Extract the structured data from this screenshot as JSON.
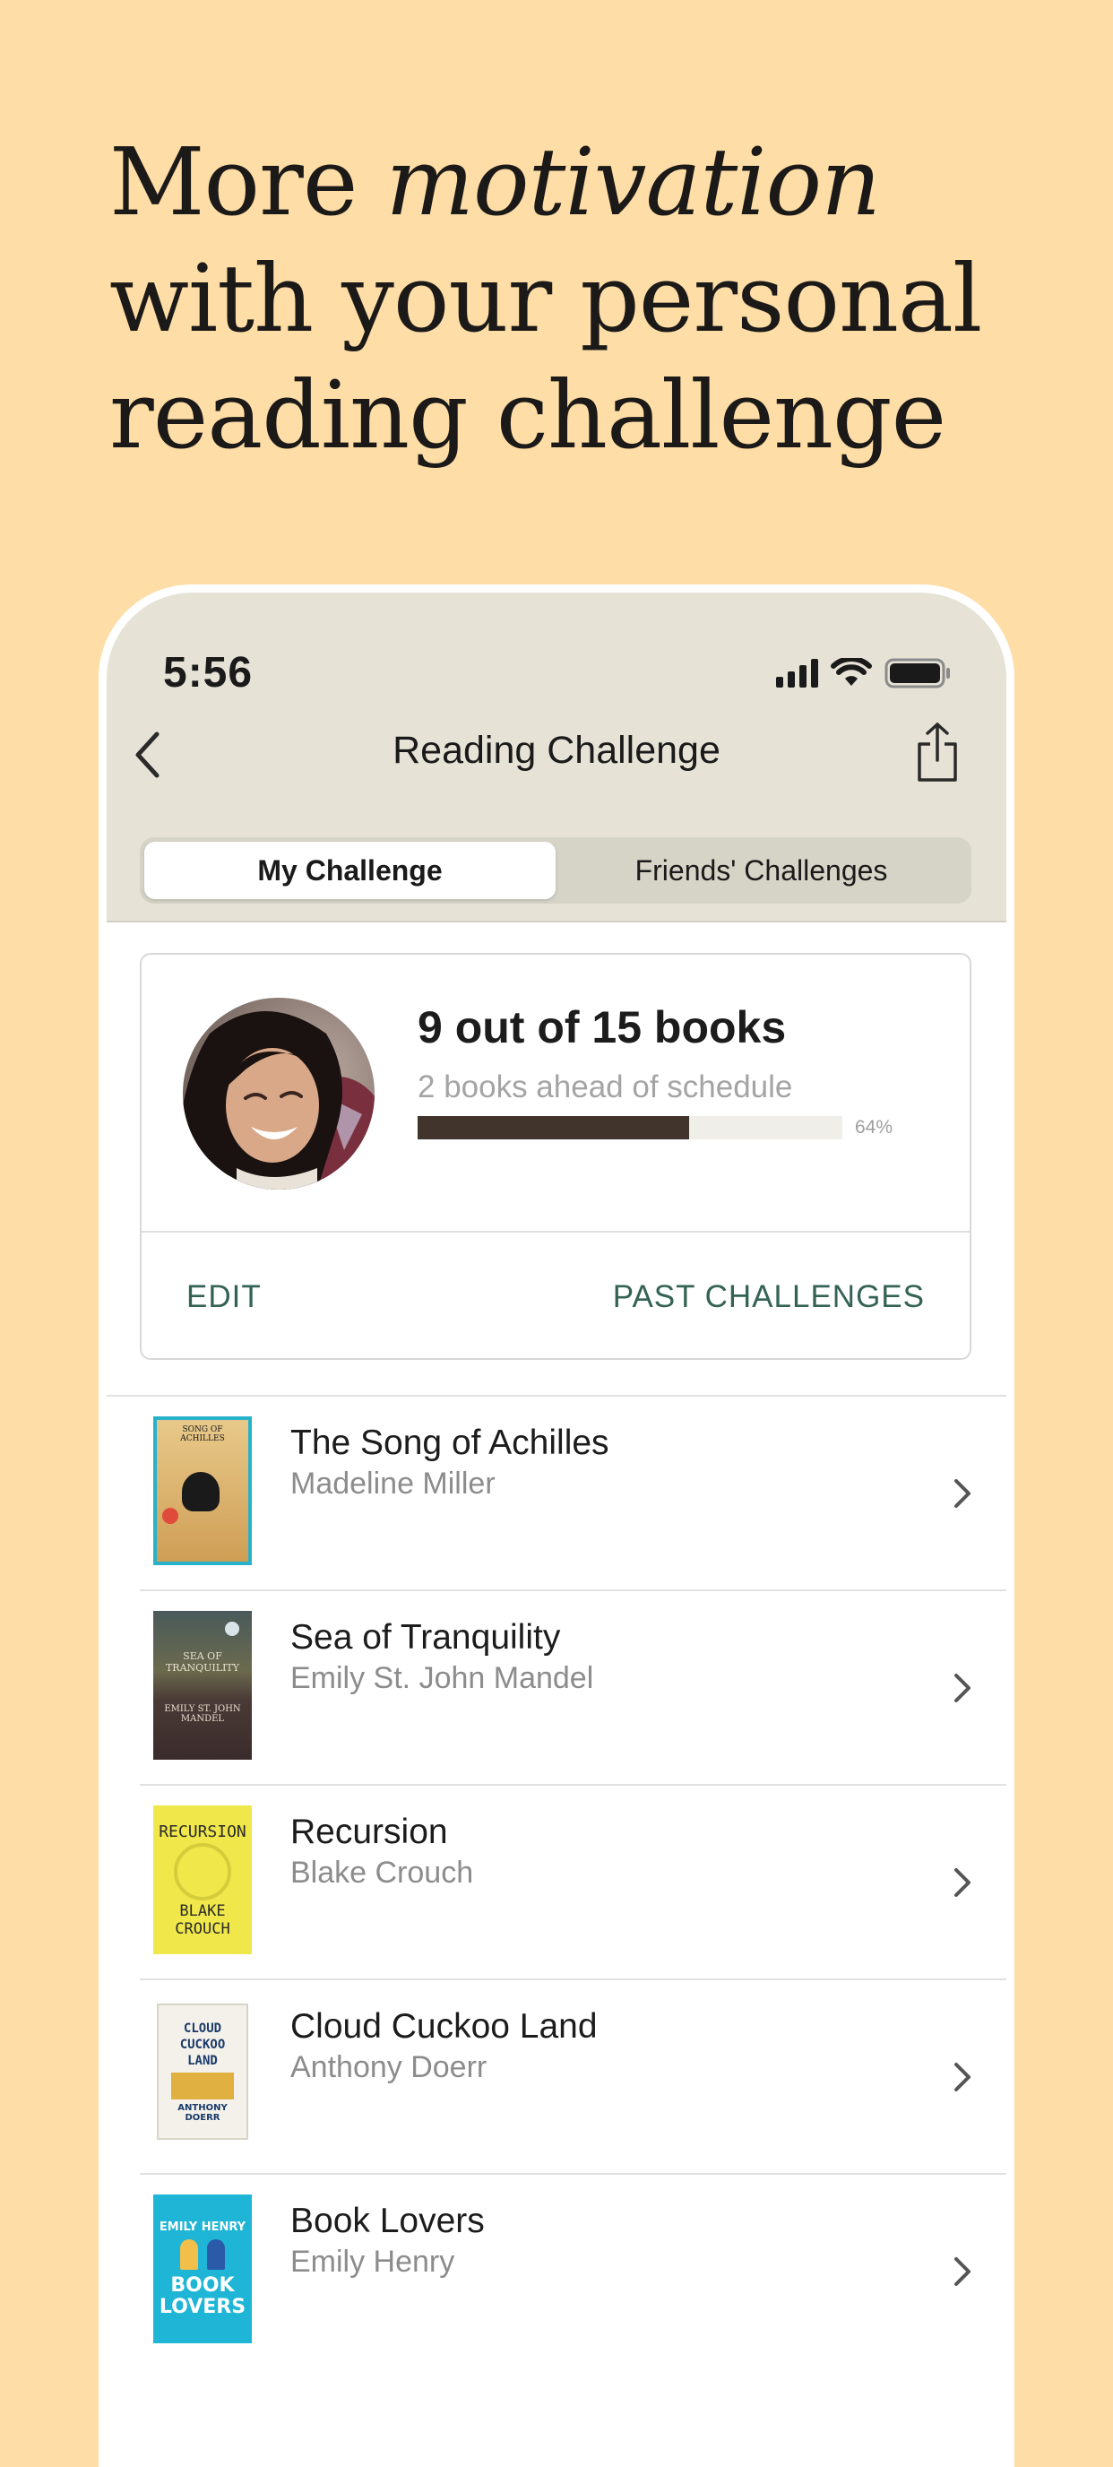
{
  "headline": {
    "line1_pre": "More ",
    "line1_em": "motivation",
    "line2": "with your personal",
    "line3": "reading challenge"
  },
  "status_bar": {
    "time": "5:56",
    "icons": [
      "signal-icon",
      "wifi-icon",
      "battery-icon"
    ]
  },
  "nav": {
    "title": "Reading Challenge",
    "back_icon": "chevron-left-icon",
    "share_icon": "share-icon"
  },
  "tabs": [
    {
      "label": "My Challenge",
      "active": true
    },
    {
      "label": "Friends' Challenges",
      "active": false
    }
  ],
  "challenge": {
    "title": "9 out of 15 books",
    "subtitle": "2 books ahead of schedule",
    "progress_percent": 64,
    "progress_label": "64%",
    "edit_label": "EDIT",
    "past_label": "PAST CHALLENGES"
  },
  "books": [
    {
      "title": "The Song of Achilles",
      "author": "Madeline Miller"
    },
    {
      "title": "Sea of Tranquility",
      "author": "Emily St. John Mandel"
    },
    {
      "title": "Recursion",
      "author": "Blake Crouch"
    },
    {
      "title": "Cloud Cuckoo Land",
      "author": "Anthony Doerr"
    },
    {
      "title": "Book Lovers",
      "author": "Emily Henry"
    }
  ],
  "colors": {
    "background": "#FEDDA6",
    "header": "#E6E3D6",
    "accent": "#346356",
    "progress": "#40342C"
  }
}
